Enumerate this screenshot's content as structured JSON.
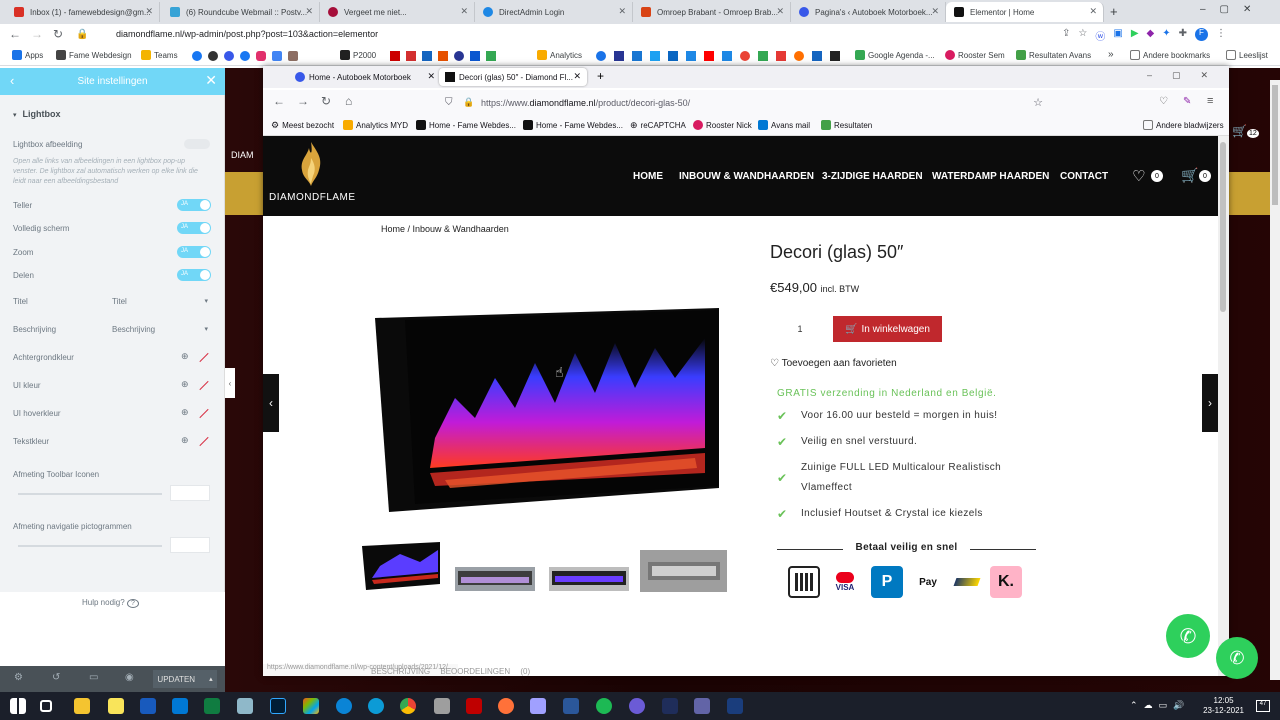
{
  "chrome": {
    "tabs": [
      {
        "label": "Inbox (1) - famewebdesign@gm...",
        "color": "#d93025"
      },
      {
        "label": "(6) Roundcube Webmail :: Postv...",
        "color": "#37a3d6"
      },
      {
        "label": "Vergeet me niet...",
        "color": "#a50e3a"
      },
      {
        "label": "DirectAdmin Login",
        "color": "#1e88e5"
      },
      {
        "label": "Omroep Brabant - Omroep Brab...",
        "color": "#d84315"
      },
      {
        "label": "Pagina's ‹ Autoboek Motorboek...",
        "color": "#3858e9"
      },
      {
        "label": "Elementor | Home",
        "color": "#111111"
      }
    ],
    "url": "diamondflame.nl/wp-admin/post.php?post=103&action=elementor",
    "bookmarks": [
      "Apps",
      "Fame Webdesign",
      "Teams",
      "P2000",
      "Analytics",
      "Google Agenda -...",
      "Rooster Sem",
      "Resultaten Avans"
    ],
    "other_bookmarks": "Andere bookmarks",
    "reading_list": "Leeslijst"
  },
  "panel": {
    "title": "Site instellingen",
    "section": "Lightbox",
    "lightbox_image_label": "Lightbox afbeelding",
    "lightbox_desc": "Open alle links van afbeeldingen in een lightbox pop-up venster. De lightbox zal automatisch werken op elke link die leidt naar een afbeeldingsbestand",
    "toggles": [
      {
        "label": "Teller",
        "state": "JA"
      },
      {
        "label": "Volledig scherm",
        "state": "JA"
      },
      {
        "label": "Zoom",
        "state": "JA"
      },
      {
        "label": "Delen",
        "state": "JA"
      }
    ],
    "selects": [
      {
        "label": "Titel",
        "value": "Titel"
      },
      {
        "label": "Beschrijving",
        "value": "Beschrijving"
      }
    ],
    "colors": [
      "Achtergrondkleur",
      "UI kleur",
      "UI hoverkleur",
      "Tekstkleur"
    ],
    "sliders": [
      "Afmeting Toolbar Iconen",
      "Afmeting navigatie pictogrammen"
    ],
    "help": "Hulp nodig?",
    "update": "UPDATEN"
  },
  "firefox": {
    "tabs": [
      "Home - Autoboek Motorboek",
      "Decori (glas) 50″ - Diamond Fl..."
    ],
    "url_prefix": "https://www.",
    "url_domain": "diamondflame.nl",
    "url_path": "/product/decori-glas-50/",
    "bookmarks": [
      "Meest bezocht",
      "Analytics MYD",
      "Home - Fame Webdes...",
      "Home - Fame Webdes...",
      "reCAPTCHA",
      "Rooster Nick",
      "Avans mail",
      "Resultaten"
    ],
    "other": "Andere bladwijzers"
  },
  "site": {
    "logo": "DIAMONDFLAME",
    "menu": [
      "HOME",
      "INBOUW & WANDHAARDEN",
      "3-ZIJDIGE HAARDEN",
      "WATERDAMP HAARDEN",
      "CONTACT"
    ],
    "wishlist_count": "0",
    "cart_count": "0",
    "breadcrumb_home": "Home",
    "breadcrumb_sep": " / ",
    "breadcrumb_cat": "Inbouw & Wandhaarden",
    "title": "Decori (glas) 50″",
    "price": "€549,00",
    "price_suffix": "incl. BTW",
    "quantity": "1",
    "add_to_cart": "In winkelwagen",
    "wishlist": "Toevoegen aan favorieten",
    "shipping": "GRATIS verzending in Nederland en België.",
    "usps": [
      "Voor 16.00 uur besteld = morgen in huis!",
      "Veilig en snel verstuurd.",
      "Zuinige FULL LED Multicalour Realistisch Vlameffect",
      "Inclusief Houtset & Crystal ice kiezels"
    ],
    "pay_title": "Betaal veilig en snel",
    "pay_methods": [
      "iDEAL",
      "Mastercard / VISA",
      "PayPal",
      "Apple Pay",
      "Bancontact",
      "Klarna"
    ],
    "tabs_label": "BESCHRIJVING   BEOORDELINGEN (0)",
    "status_url": "https://www.diamondflame.nl/wp-content/uploads/2021/12/..."
  },
  "taskbar": {
    "time": "12:05",
    "date": "23-12-2021",
    "battery": "47"
  }
}
